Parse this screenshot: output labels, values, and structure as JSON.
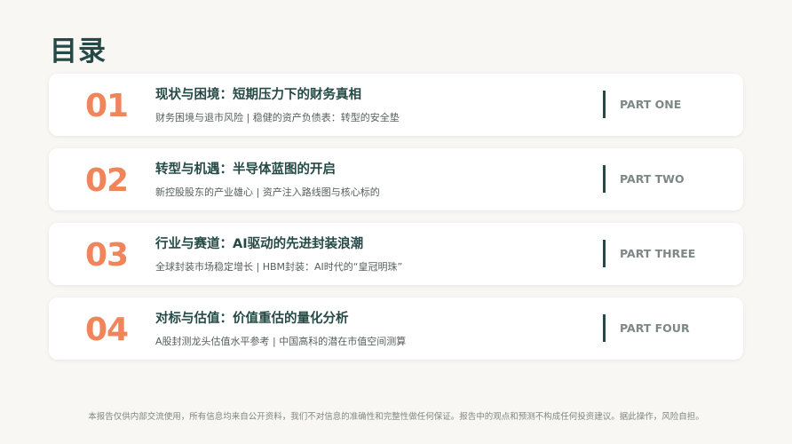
{
  "title": "目录",
  "items": [
    {
      "number": "01",
      "heading": "现状与困境：短期压力下的财务真相",
      "subtitle": "财务困境与退市风险 | 稳健的资产负债表：转型的安全垫",
      "part": "PART ONE"
    },
    {
      "number": "02",
      "heading": "转型与机遇：半导体蓝图的开启",
      "subtitle": "新控股股东的产业雄心 | 资产注入路线图与核心标的",
      "part": "PART TWO"
    },
    {
      "number": "03",
      "heading": "行业与赛道：AI驱动的先进封装浪潮",
      "subtitle": "全球封装市场稳定增长 | HBM封装：AI时代的“皇冠明珠”",
      "part": "PART THREE"
    },
    {
      "number": "04",
      "heading": "对标与估值：价值重估的量化分析",
      "subtitle": "A股封测龙头估值水平参考 | 中国高科的潜在市值空间测算",
      "part": "PART FOUR"
    }
  ],
  "footer": "本报告仅供内部交流使用，所有信息均来自公开资料，我们不对信息的准确性和完整性做任何保证。报告中的观点和预测不构成任何投资建议。据此操作，风险自担。",
  "colors": {
    "accent": "#f0845a",
    "primary": "#254a46",
    "background": "#f8f7f3"
  }
}
